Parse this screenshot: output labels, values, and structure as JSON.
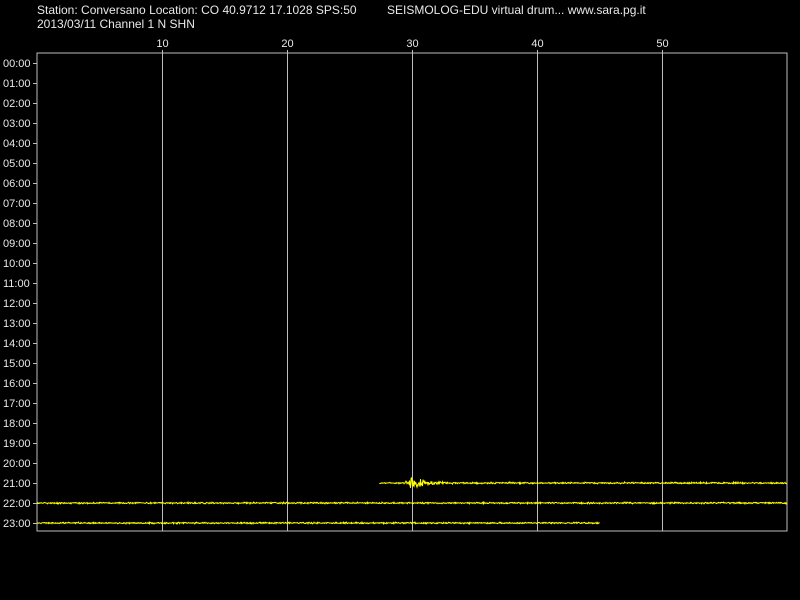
{
  "header": {
    "station_line": "Station: Conversano Location: CO 40.9712 17.1028 SPS:50",
    "software_line": "SEISMOLOG-EDU virtual drum... www.sara.pg.it",
    "date_channel_line": "2013/03/11  Channel 1 N SHN"
  },
  "colors": {
    "background": "#000000",
    "trace": "#ffff00",
    "grid": "#bdbdbd",
    "text": "#e8e8e8"
  },
  "chart_data": {
    "type": "line",
    "title": "",
    "xlabel": "",
    "ylabel": "",
    "x_ticks": [
      10,
      20,
      30,
      40,
      50
    ],
    "xlim": [
      0,
      60
    ],
    "y_ticks": [
      "00:00",
      "01:00",
      "02:00",
      "03:00",
      "04:00",
      "05:00",
      "06:00",
      "07:00",
      "08:00",
      "09:00",
      "10:00",
      "11:00",
      "12:00",
      "13:00",
      "14:00",
      "15:00",
      "16:00",
      "17:00",
      "18:00",
      "19:00",
      "20:00",
      "21:00",
      "22:00",
      "23:00"
    ],
    "grid": "vertical lines at x ticks",
    "series": [
      {
        "row": "21:00",
        "start_minute": 27.4,
        "end_minute": 60,
        "event_minute": 29.8,
        "event_peak_rows": 0.85
      },
      {
        "row": "22:00",
        "start_minute": 0,
        "end_minute": 60
      },
      {
        "row": "23:00",
        "start_minute": 0,
        "end_minute": 45
      }
    ]
  }
}
